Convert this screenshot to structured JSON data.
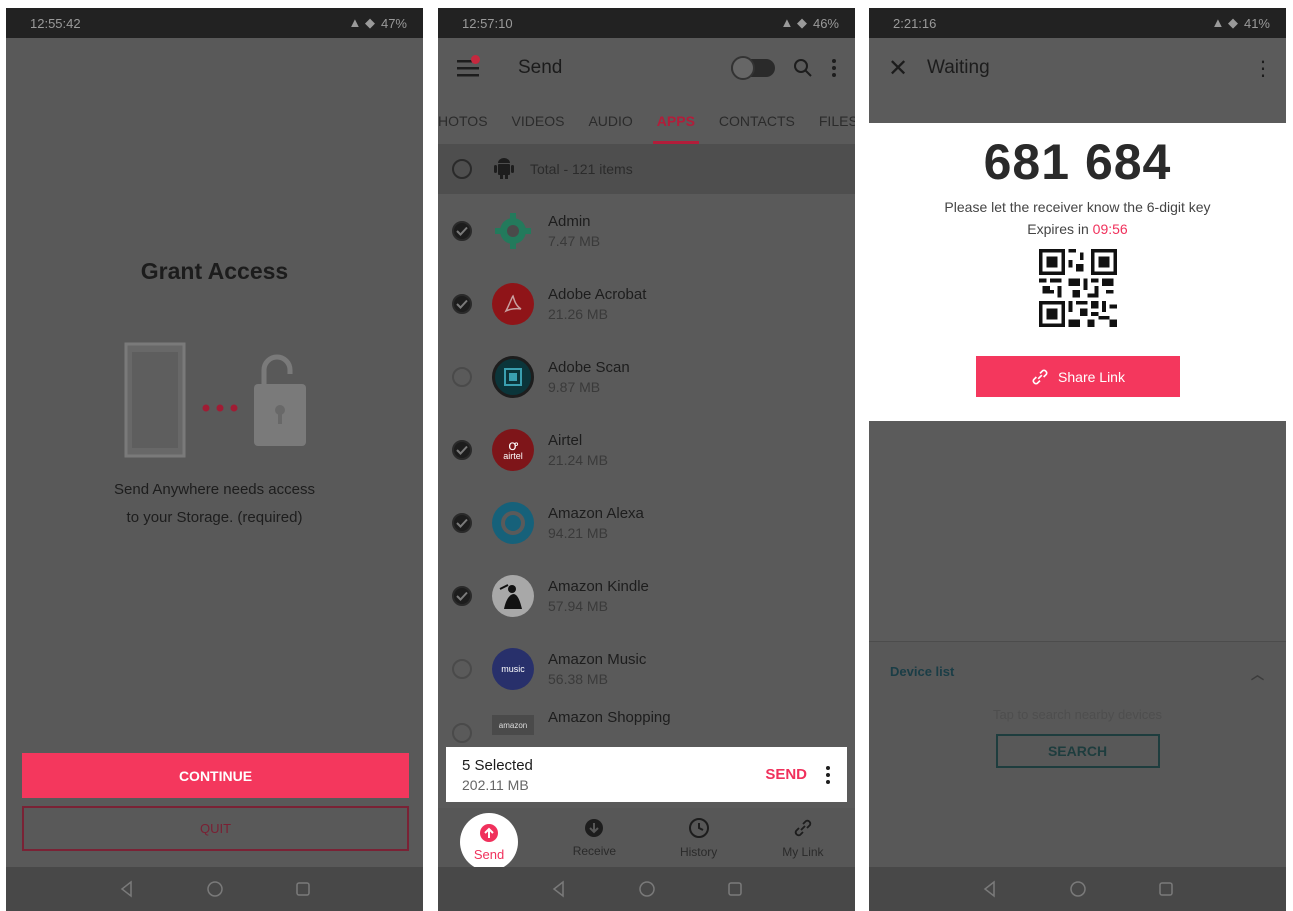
{
  "panel1": {
    "status_time": "12:55:42",
    "battery": "47%",
    "title": "Grant Access",
    "desc_line1": "Send Anywhere needs access",
    "desc_line2": "to your Storage. (required)",
    "continue_label": "CONTINUE",
    "quit_label": "QUIT",
    "accent": "#f4375d"
  },
  "panel2": {
    "status_time": "12:57:10",
    "battery": "46%",
    "title": "Send",
    "tabs": [
      "HOTOS",
      "VIDEOS",
      "AUDIO",
      "APPS",
      "CONTACTS",
      "FILES"
    ],
    "active_tab": "APPS",
    "total": "Total - 121 items",
    "apps": [
      {
        "name": "Admin",
        "size": "7.47 MB",
        "checked": true,
        "icon": "gear-icon",
        "color": "#2b8f6c"
      },
      {
        "name": "Adobe Acrobat",
        "size": "21.26 MB",
        "checked": true,
        "icon": "acrobat-icon",
        "color": "#a3161e"
      },
      {
        "name": "Adobe Scan",
        "size": "9.87 MB",
        "checked": false,
        "icon": "scan-icon",
        "color": "#0d3f47"
      },
      {
        "name": "Airtel",
        "size": "21.24 MB",
        "checked": true,
        "icon": "airtel-icon",
        "color": "#8f1a22"
      },
      {
        "name": "Amazon Alexa",
        "size": "94.21 MB",
        "checked": true,
        "icon": "alexa-icon",
        "color": "#1b6f8a"
      },
      {
        "name": "Amazon Kindle",
        "size": "57.94 MB",
        "checked": true,
        "icon": "kindle-icon",
        "color": "#1d2a38"
      },
      {
        "name": "Amazon Music",
        "size": "56.38 MB",
        "checked": false,
        "icon": "music-icon",
        "color": "#2a2f6b"
      },
      {
        "name": "Amazon Shopping",
        "size": "",
        "checked": false,
        "icon": "amazon-icon",
        "color": "#4a4a4a"
      }
    ],
    "amazon_icon_text": "amazon",
    "music_icon_text": "music",
    "airtel_icon_text": "airtel",
    "selected": "5 Selected",
    "selected_size": "202.11 MB",
    "send_action": "SEND",
    "nav": {
      "send": "Send",
      "receive": "Receive",
      "history": "History",
      "mylink": "My Link"
    }
  },
  "panel3": {
    "status_time": "2:21:16",
    "battery": "41%",
    "title": "Waiting",
    "key": "681 684",
    "instruction": "Please let the receiver know the 6-digit key",
    "expires_prefix": "Expires in",
    "expires_time": "09:56",
    "share_label": "Share Link",
    "device_list": "Device list",
    "hint": "Tap to search nearby devices",
    "search_label": "SEARCH"
  }
}
